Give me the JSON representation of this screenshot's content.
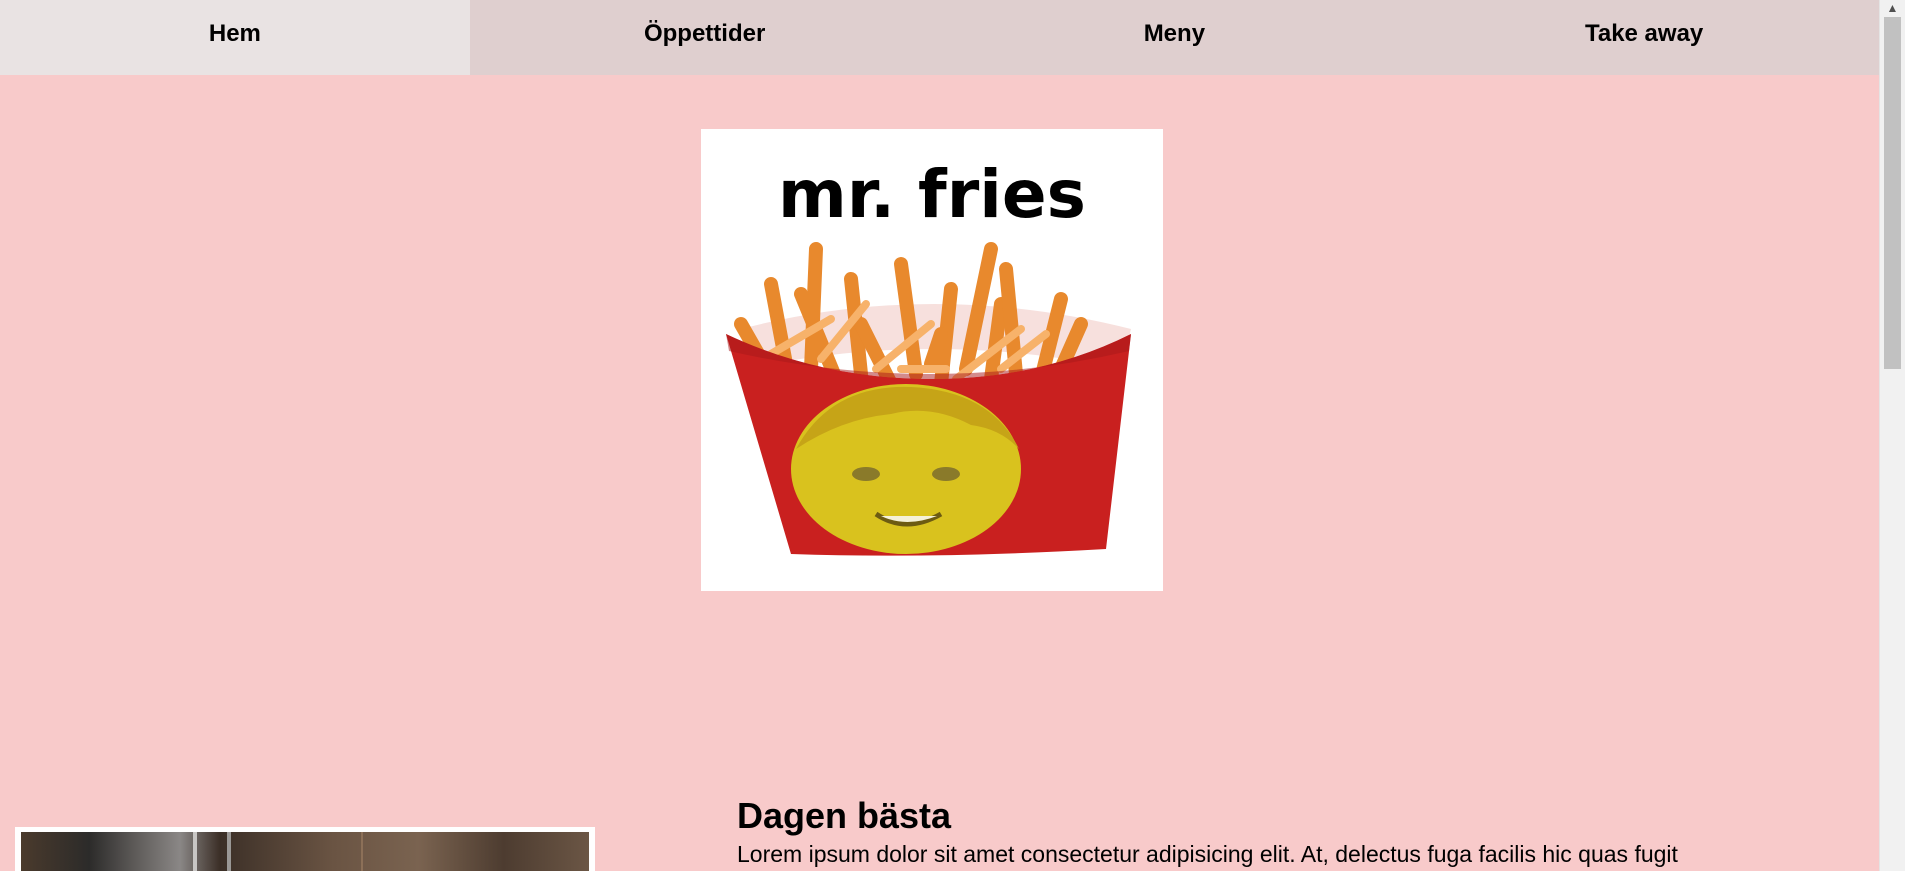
{
  "nav": {
    "items": [
      {
        "label": "Hem",
        "active": true
      },
      {
        "label": "Öppettider",
        "active": false
      },
      {
        "label": "Meny",
        "active": false
      },
      {
        "label": "Take away",
        "active": false
      }
    ]
  },
  "logo": {
    "wordmark": "mr. fries"
  },
  "content": {
    "headline": "Dagen bästa",
    "body": "Lorem ipsum dolor sit amet consectetur adipisicing elit. At, delectus fuga facilis hic quas fugit"
  },
  "colors": {
    "page_background": "#f8caca",
    "nav_background": "#dfcfcf",
    "nav_active": "#e9e3e3",
    "fries_box_red": "#c9201f",
    "fries_orange": "#f5a04a"
  }
}
